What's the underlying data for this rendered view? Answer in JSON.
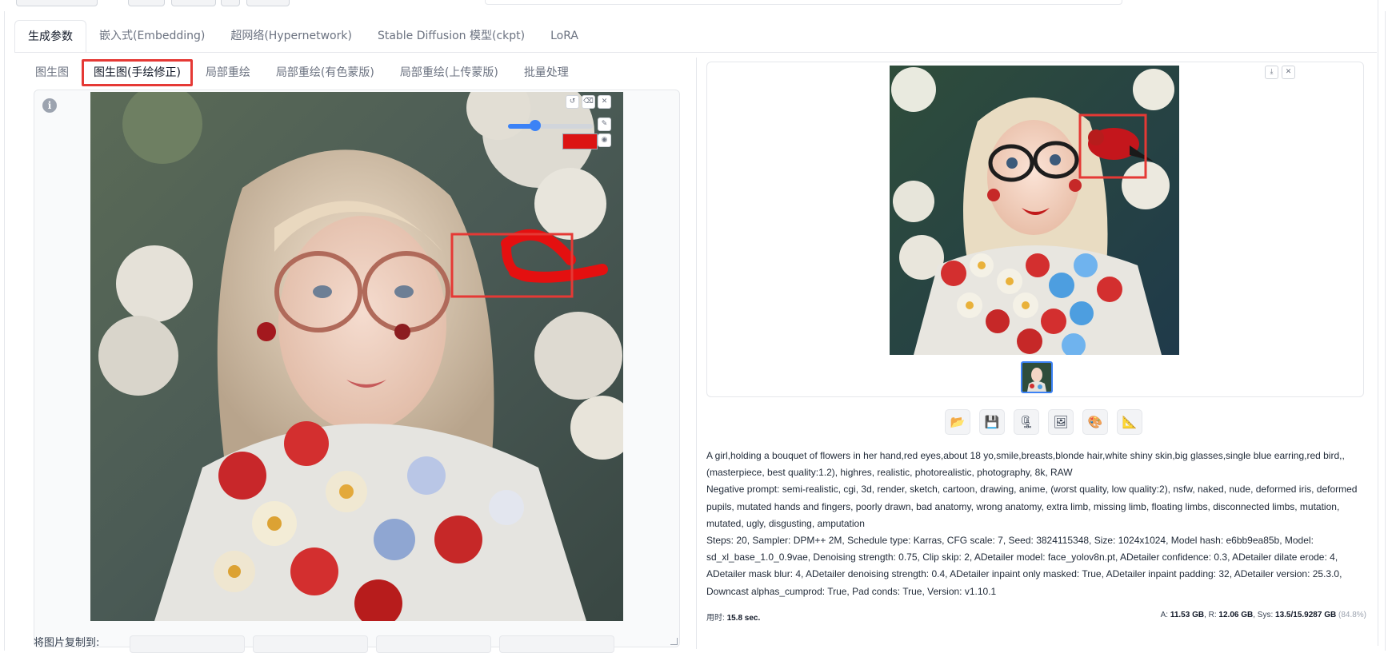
{
  "top_tabs": [
    {
      "label": "生成参数"
    },
    {
      "label": "嵌入式(Embedding)"
    },
    {
      "label": "超网络(Hypernetwork)"
    },
    {
      "label": "Stable Diffusion 模型(ckpt)"
    },
    {
      "label": "LoRA"
    }
  ],
  "sub_tabs": [
    {
      "label": "图生图"
    },
    {
      "label": "图生图(手绘修正)"
    },
    {
      "label": "局部重绘"
    },
    {
      "label": "局部重绘(有色蒙版)"
    },
    {
      "label": "局部重绘(上传蒙版)"
    },
    {
      "label": "批量处理"
    }
  ],
  "info_icon": {
    "glyph": "i"
  },
  "canvas_tools": {
    "undo": "↺",
    "erase": "⌫",
    "close": "✕",
    "brush": "✎",
    "palette": "◉",
    "brush_size_fraction": 0.32,
    "brush_color": "#dc1414"
  },
  "copy_to": {
    "label": "将图片复制到:"
  },
  "gallery_tools": {
    "download": "⤓",
    "close": "✕"
  },
  "actions": [
    {
      "name": "folder-icon",
      "glyph": "📂"
    },
    {
      "name": "save-icon",
      "glyph": "💾"
    },
    {
      "name": "zip-icon",
      "glyph": "🗜"
    },
    {
      "name": "image-icon",
      "glyph": "🖼"
    },
    {
      "name": "palette-icon",
      "glyph": "🎨"
    },
    {
      "name": "ruler-icon",
      "glyph": "📐"
    }
  ],
  "params": {
    "line1": "A girl,holding a bouquet of flowers in her hand,red eyes,about 18 yo,smile,breasts,blonde hair,white shiny skin,big glasses,single blue earring,red bird,,",
    "line2": "(masterpiece, best quality:1.2), highres, realistic, photorealistic, photography, 8k, RAW",
    "negative": "Negative prompt: semi-realistic, cgi, 3d, render, sketch, cartoon, drawing, anime, (worst quality, low quality:2), nsfw, naked, nude, deformed iris, deformed pupils, mutated hands and fingers, poorly drawn, bad anatomy, wrong anatomy, extra limb, missing limb, floating limbs, disconnected limbs, mutation, mutated, ugly, disgusting, amputation",
    "settings": "Steps: 20, Sampler: DPM++ 2M, Schedule type: Karras, CFG scale: 7, Seed: 3824115348, Size: 1024x1024, Model hash: e6bb9ea85b, Model: sd_xl_base_1.0_0.9vae, Denoising strength: 0.75, Clip skip: 2, ADetailer model: face_yolov8n.pt, ADetailer confidence: 0.3, ADetailer dilate erode: 4, ADetailer mask blur: 4, ADetailer denoising strength: 0.4, ADetailer inpaint only masked: True, ADetailer inpaint padding: 32, ADetailer version: 25.3.0, Downcast alphas_cumprod: True, Pad conds: True, Version: v1.10.1"
  },
  "footer": {
    "time_label": "用时:",
    "time_value": "15.8 sec.",
    "a_label": "A:",
    "a_value": "11.53 GB",
    "r_label": "R:",
    "r_value": "12.06 GB",
    "sys_label": "Sys:",
    "sys_value": "13.5/15.9287 GB",
    "sys_pct": "(84.8%)"
  },
  "colors": {
    "highlight": "#e53935",
    "accent": "#3b82f6"
  }
}
